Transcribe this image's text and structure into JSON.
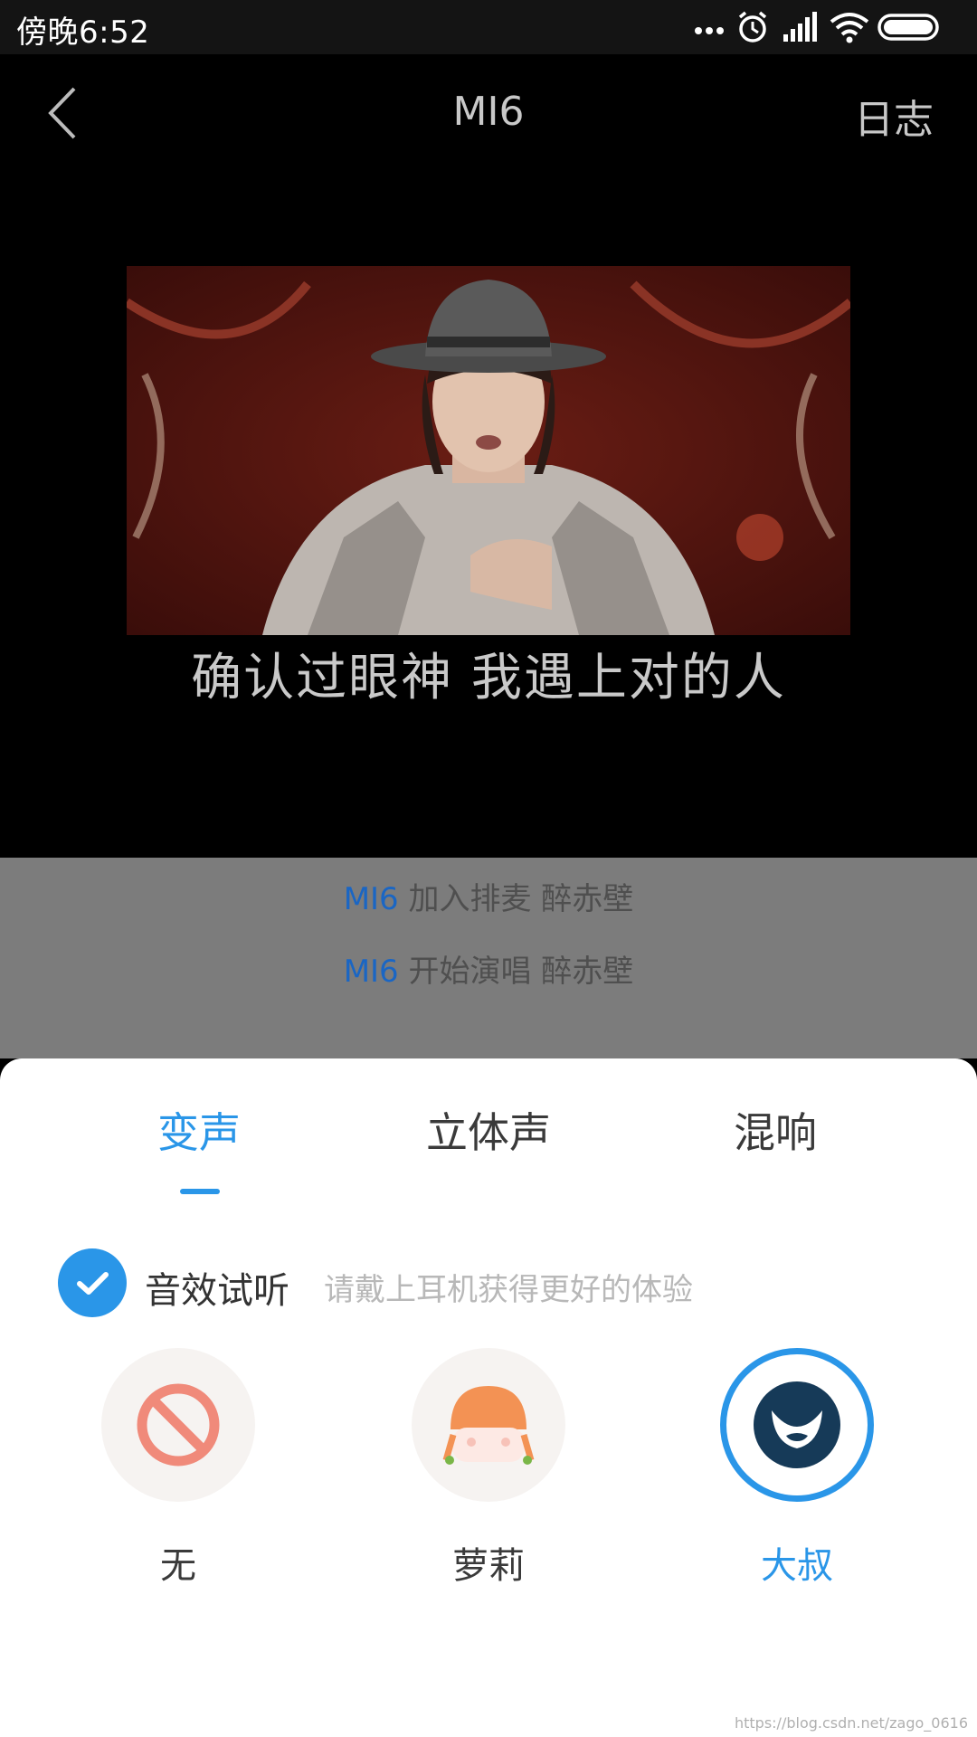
{
  "status_bar": {
    "time": "傍晚6:52"
  },
  "nav": {
    "title": "MI6",
    "log_label": "日志"
  },
  "video": {
    "subtitle": "确认过眼神  我遇上对的人"
  },
  "chat": [
    {
      "user": "MI6",
      "text": "加入排麦 醉赤壁"
    },
    {
      "user": "MI6",
      "text": "开始演唱 醉赤壁"
    }
  ],
  "tabs": [
    {
      "label": "变声",
      "active": true
    },
    {
      "label": "立体声",
      "active": false
    },
    {
      "label": "混响",
      "active": false
    }
  ],
  "preview": {
    "label": "音效试听",
    "hint": "请戴上耳机获得更好的体验",
    "checked": true
  },
  "effects": [
    {
      "label": "无",
      "icon": "none-icon",
      "selected": false
    },
    {
      "label": "萝莉",
      "icon": "loli-girl-icon",
      "selected": false
    },
    {
      "label": "大叔",
      "icon": "uncle-beard-icon",
      "selected": true
    }
  ],
  "colors": {
    "accent": "#2a96e8",
    "chat_user": "#1a66c4"
  },
  "watermark": "https://blog.csdn.net/zago_0616"
}
